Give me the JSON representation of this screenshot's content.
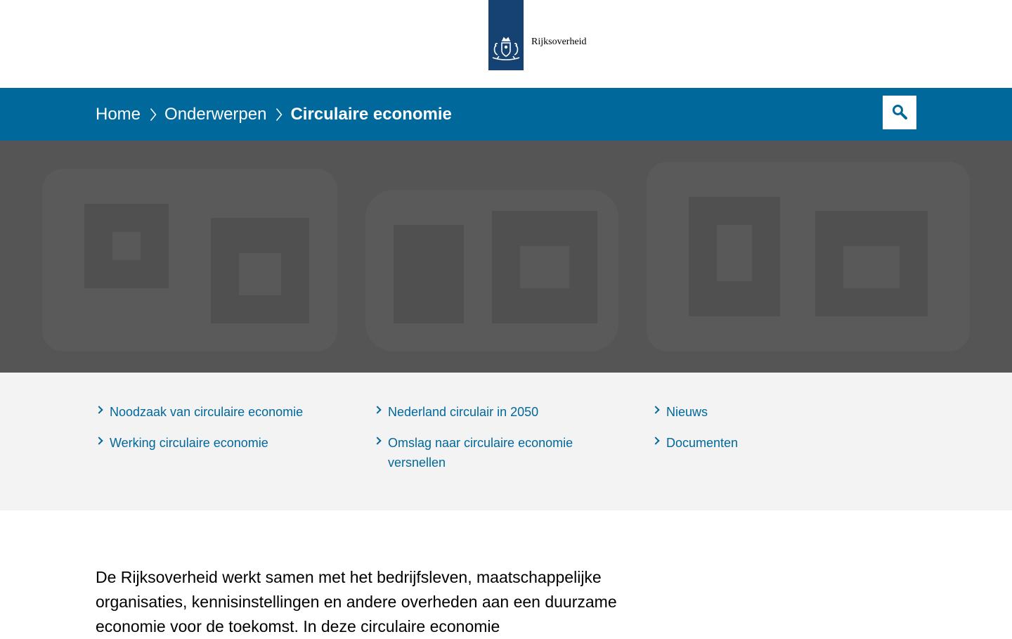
{
  "header": {
    "logo_text": "Rijksoverheid"
  },
  "breadcrumb": {
    "home": "Home",
    "topics": "Onderwerpen",
    "current": "Circulaire economie"
  },
  "search": {
    "icon": "search-icon"
  },
  "colors": {
    "brand_blue": "#01689b",
    "logo_blue": "#154273",
    "subnav_bg": "#f3f3f3",
    "hero_gray": "#555555"
  },
  "subnav": {
    "col1": [
      "Noodzaak van circulaire economie",
      "Werking circulaire economie"
    ],
    "col2": [
      "Nederland circulair in 2050",
      "Omslag naar circulaire economie versnellen"
    ],
    "col3": [
      "Nieuws",
      "Documenten"
    ]
  },
  "intro": {
    "text": "De Rijksoverheid werkt samen met het bedrijfsleven, maatschappelijke organisaties, kennisinstellingen en andere overheden aan een duurzame economie voor de toekomst. In deze circulaire economie"
  }
}
